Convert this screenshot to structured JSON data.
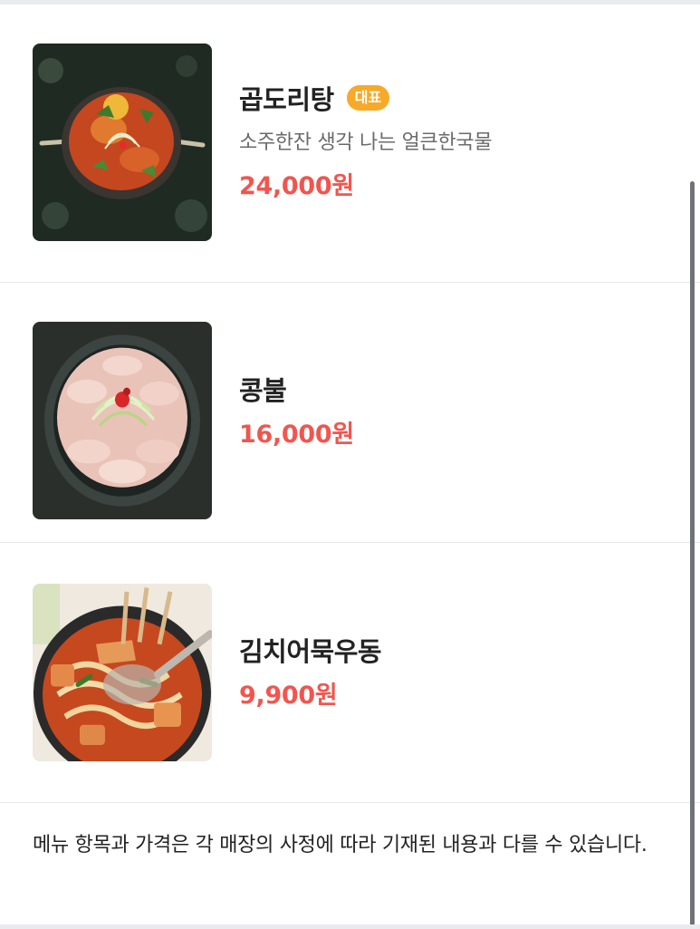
{
  "menu": {
    "items": [
      {
        "name": "곱도리탕",
        "badge": "대표",
        "description": "소주한잔 생각 나는 얼큰한국물",
        "price": "24,000원",
        "image": "gopdoritang-photo"
      },
      {
        "name": "콩불",
        "price": "16,000원",
        "image": "kongbul-photo"
      },
      {
        "name": "김치어묵우동",
        "price": "9,900원",
        "image": "kimchi-eomuk-udon-photo"
      }
    ]
  },
  "notice": {
    "text": "메뉴 항목과 가격은 각 매장의 사정에 따라 기재된 내용과 다를 수 있습니다."
  },
  "colors": {
    "price": "#f0564f",
    "badge": "#f7a928",
    "divider": "#e8e8e8"
  }
}
